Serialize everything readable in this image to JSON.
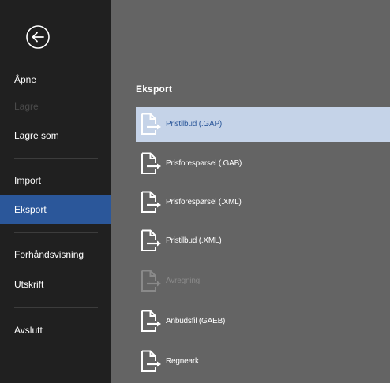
{
  "colors": {
    "nav_background": "#202020",
    "content_background": "#646464",
    "active_nav": "#2b579a",
    "selected_item": "#c5d3e8",
    "selected_text": "#2b579a",
    "disabled_text": "#8a8a8a"
  },
  "nav": {
    "back_icon": "back-arrow-circle-icon",
    "items": [
      {
        "label": "Åpne",
        "state": "normal"
      },
      {
        "label": "Lagre",
        "state": "disabled"
      },
      {
        "label": "Lagre som",
        "state": "normal"
      },
      {
        "label": "Import",
        "state": "normal"
      },
      {
        "label": "Eksport",
        "state": "active"
      },
      {
        "label": "Forhåndsvisning",
        "state": "normal"
      },
      {
        "label": "Utskrift",
        "state": "normal"
      },
      {
        "label": "Avslutt",
        "state": "normal"
      }
    ]
  },
  "content": {
    "title": "Eksport",
    "items": [
      {
        "label": "Pristilbud (.GAP)",
        "icon": "export-document-icon",
        "state": "selected"
      },
      {
        "label": "Prisforespørsel (.GAB)",
        "icon": "export-document-icon",
        "state": "normal"
      },
      {
        "label": "Prisforespørsel (.XML)",
        "icon": "export-document-icon",
        "state": "normal"
      },
      {
        "label": "Pristilbud (.XML)",
        "icon": "export-document-icon",
        "state": "normal"
      },
      {
        "label": "Avregning",
        "icon": "export-document-icon",
        "state": "disabled"
      },
      {
        "label": "Anbudsfil (GAEB)",
        "icon": "export-document-icon",
        "state": "normal"
      },
      {
        "label": "Regneark",
        "icon": "export-document-icon",
        "state": "normal"
      }
    ]
  }
}
